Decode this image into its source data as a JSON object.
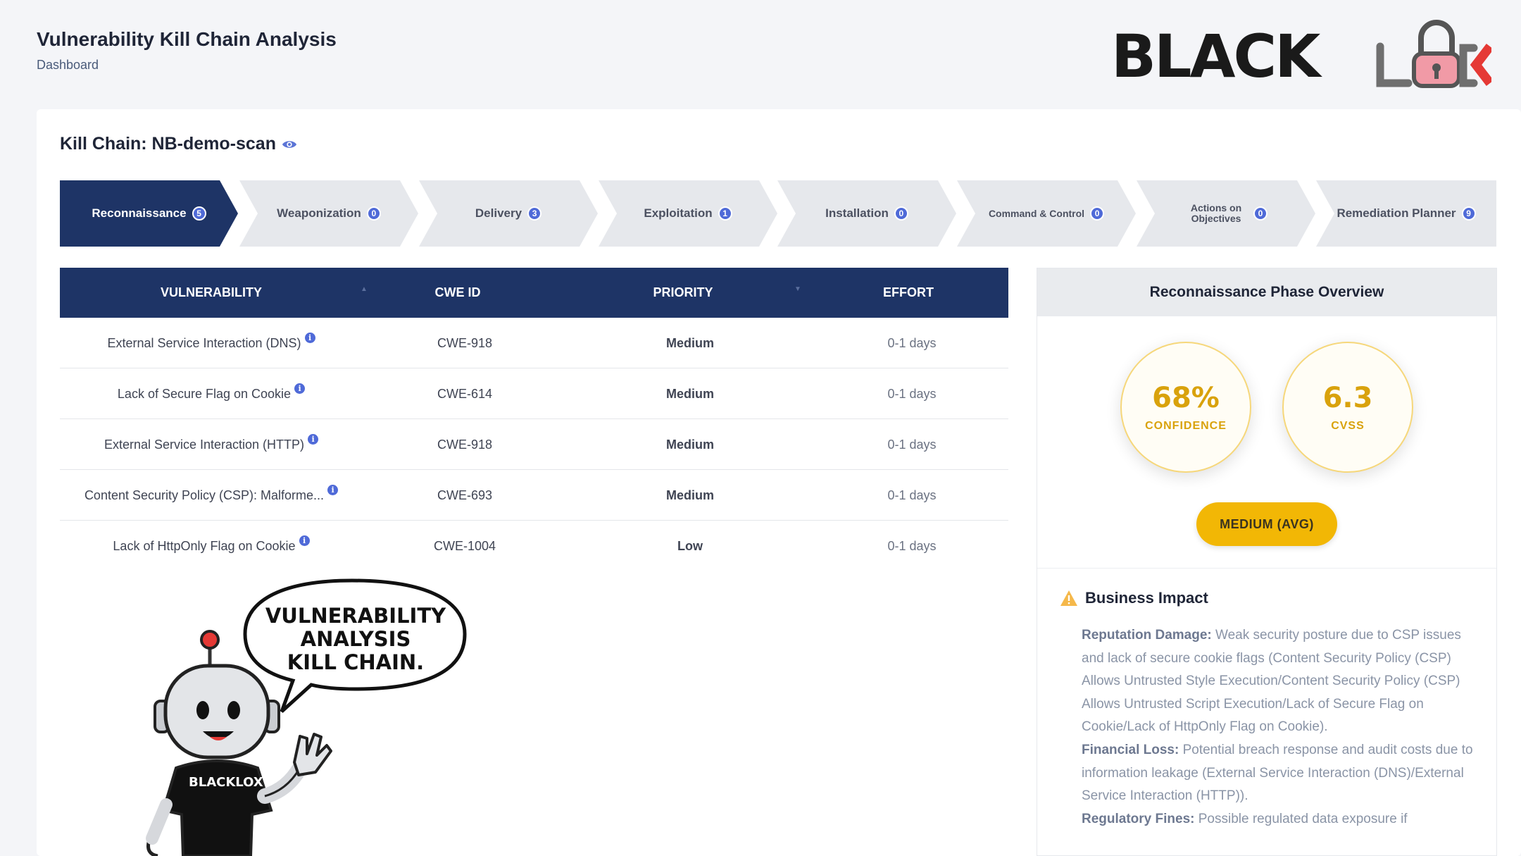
{
  "header": {
    "title": "Vulnerability Kill Chain Analysis",
    "breadcrumb": "Dashboard",
    "logo_text": "BLACK L",
    "logo_full": "BLACK LOCK"
  },
  "kill_chain": {
    "title": "Kill Chain: NB-demo-scan",
    "steps": [
      {
        "label": "Reconnaissance",
        "count": "5"
      },
      {
        "label": "Weaponization",
        "count": "0"
      },
      {
        "label": "Delivery",
        "count": "3"
      },
      {
        "label": "Exploitation",
        "count": "1"
      },
      {
        "label": "Installation",
        "count": "0"
      },
      {
        "label": "Command & Control",
        "count": "0"
      },
      {
        "label": "Actions on Objectives",
        "count": "0"
      },
      {
        "label": "Remediation Planner",
        "count": "9"
      }
    ],
    "active_step": "Reconnaissance"
  },
  "table": {
    "columns": [
      "VULNERABILITY",
      "CWE ID",
      "PRIORITY",
      "EFFORT"
    ],
    "rows": [
      {
        "vulnerability": "External Service Interaction (DNS)",
        "cwe": "CWE-918",
        "priority": "Medium",
        "effort": "0-1 days"
      },
      {
        "vulnerability": "Lack of Secure Flag on Cookie",
        "cwe": "CWE-614",
        "priority": "Medium",
        "effort": "0-1 days"
      },
      {
        "vulnerability": "External Service Interaction (HTTP)",
        "cwe": "CWE-918",
        "priority": "Medium",
        "effort": "0-1 days"
      },
      {
        "vulnerability": "Content Security Policy (CSP): Malforme...",
        "cwe": "CWE-693",
        "priority": "Medium",
        "effort": "0-1 days"
      },
      {
        "vulnerability": "Lack of HttpOnly Flag on Cookie",
        "cwe": "CWE-1004",
        "priority": "Low",
        "effort": "0-1 days"
      }
    ]
  },
  "overview": {
    "title": "Reconnaissance Phase Overview",
    "confidence_value": "68%",
    "confidence_label": "CONFIDENCE",
    "cvss_value": "6.3",
    "cvss_label": "CVSS",
    "severity_pill": "MEDIUM (AVG)",
    "business_impact_title": "Business Impact",
    "impacts": [
      {
        "label": "Reputation Damage:",
        "text": " Weak security posture due to CSP issues and lack of secure cookie flags (Content Security Policy (CSP) Allows Untrusted Style Execution/Content Security Policy (CSP) Allows Untrusted Script Execution/Lack of Secure Flag on Cookie/Lack of HttpOnly Flag on Cookie)."
      },
      {
        "label": "Financial Loss:",
        "text": " Potential breach response and audit costs due to information leakage (External Service Interaction (DNS)/External Service Interaction (HTTP))."
      },
      {
        "label": "Regulatory Fines:",
        "text": " Possible regulated data exposure if"
      }
    ]
  },
  "mascot": {
    "speech": [
      "VULNERABILITY",
      "ANALYSIS",
      "KILL CHAIN."
    ],
    "shirt": "BLACKLOX"
  },
  "colors": {
    "navy": "#1e3466",
    "accent_blue": "#4f6ad8",
    "gold": "#f2b705",
    "logo_red": "#e53935"
  }
}
